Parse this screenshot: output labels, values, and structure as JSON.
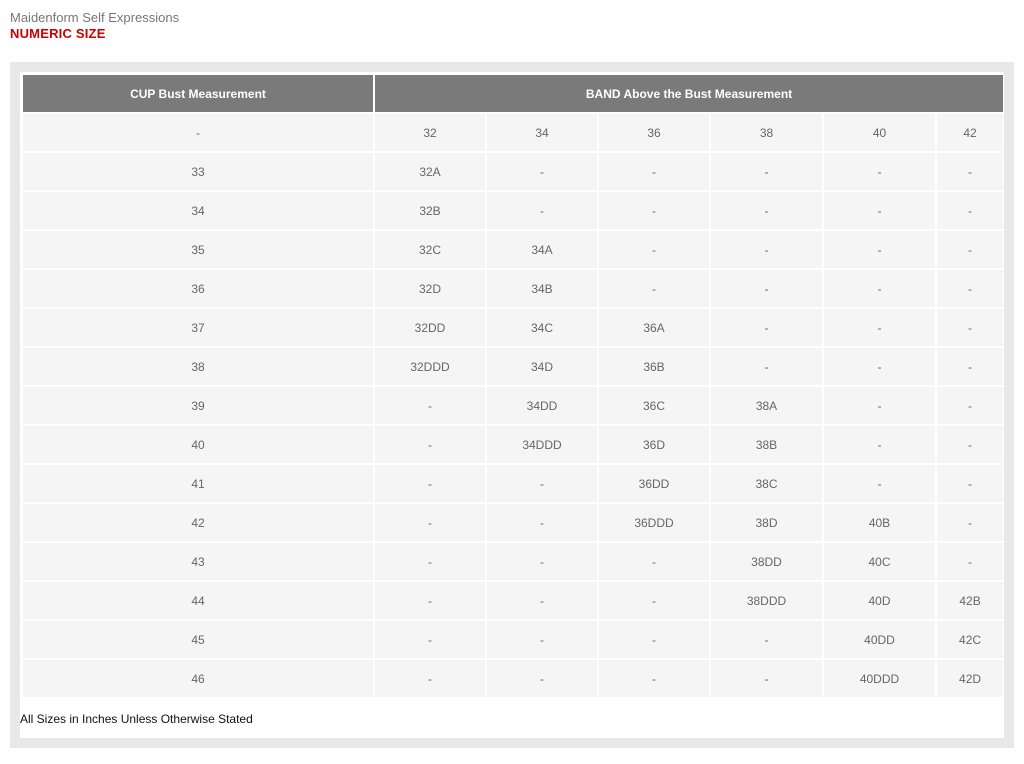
{
  "brand": "Maidenform Self Expressions",
  "section_title": "NUMERIC SIZE",
  "table": {
    "header": {
      "cup": "CUP Bust Measurement",
      "band": "BAND Above the Bust Measurement"
    },
    "band_row": {
      "label": "-",
      "bands": [
        "32",
        "34",
        "36",
        "38",
        "40",
        "42"
      ]
    },
    "rows": [
      {
        "bust": "33",
        "sizes": [
          "32A",
          "-",
          "-",
          "-",
          "-",
          "-"
        ]
      },
      {
        "bust": "34",
        "sizes": [
          "32B",
          "-",
          "-",
          "-",
          "-",
          "-"
        ]
      },
      {
        "bust": "35",
        "sizes": [
          "32C",
          "34A",
          "-",
          "-",
          "-",
          "-"
        ]
      },
      {
        "bust": "36",
        "sizes": [
          "32D",
          "34B",
          "-",
          "-",
          "-",
          "-"
        ]
      },
      {
        "bust": "37",
        "sizes": [
          "32DD",
          "34C",
          "36A",
          "-",
          "-",
          "-"
        ]
      },
      {
        "bust": "38",
        "sizes": [
          "32DDD",
          "34D",
          "36B",
          "-",
          "-",
          "-"
        ]
      },
      {
        "bust": "39",
        "sizes": [
          "-",
          "34DD",
          "36C",
          "38A",
          "-",
          "-"
        ]
      },
      {
        "bust": "40",
        "sizes": [
          "-",
          "34DDD",
          "36D",
          "38B",
          "-",
          "-"
        ]
      },
      {
        "bust": "41",
        "sizes": [
          "-",
          "-",
          "36DD",
          "38C",
          "-",
          "-"
        ]
      },
      {
        "bust": "42",
        "sizes": [
          "-",
          "-",
          "36DDD",
          "38D",
          "40B",
          "-"
        ]
      },
      {
        "bust": "43",
        "sizes": [
          "-",
          "-",
          "-",
          "38DD",
          "40C",
          "-"
        ]
      },
      {
        "bust": "44",
        "sizes": [
          "-",
          "-",
          "-",
          "38DDD",
          "40D",
          "42B"
        ]
      },
      {
        "bust": "45",
        "sizes": [
          "-",
          "-",
          "-",
          "-",
          "40DD",
          "42C"
        ]
      },
      {
        "bust": "46",
        "sizes": [
          "-",
          "-",
          "-",
          "-",
          "40DDD",
          "42D"
        ]
      }
    ]
  },
  "footnote": "All Sizes in Inches Unless Otherwise Stated",
  "colors": {
    "accent": "#cc0000",
    "header_bg": "#7a7a7a",
    "cell_bg": "#f5f5f5",
    "panel_bg": "#e8e8e8"
  }
}
